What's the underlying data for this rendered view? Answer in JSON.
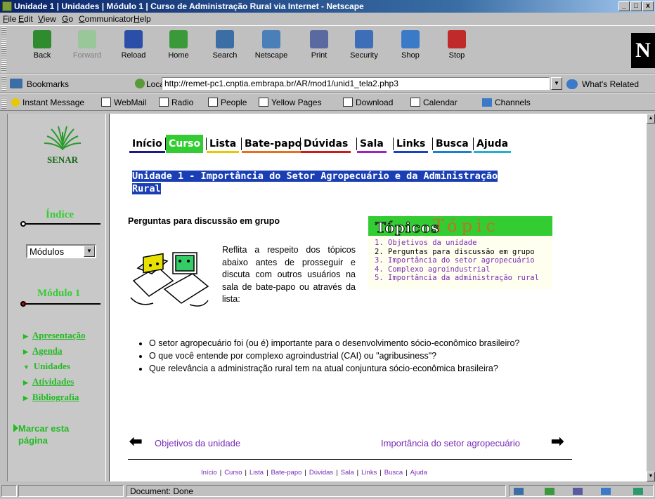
{
  "window": {
    "title": "Unidade 1 | Unidades | Módulo 1 | Curso de Administração Rural via Internet - Netscape",
    "controls": [
      "_",
      "□",
      "x"
    ]
  },
  "menu": [
    "File",
    "Edit",
    "View",
    "Go",
    "Communicator",
    "Help"
  ],
  "toolbar": {
    "buttons": [
      {
        "label": "Back",
        "icon": "back-icon",
        "color": "#2e8b2e"
      },
      {
        "label": "Forward",
        "icon": "forward-icon",
        "color": "#9ac79a"
      },
      {
        "label": "Reload",
        "icon": "reload-icon",
        "color": "#2b4fa8"
      },
      {
        "label": "Home",
        "icon": "home-icon",
        "color": "#3a9a3a"
      },
      {
        "label": "Search",
        "icon": "search-icon",
        "color": "#3a6ea5"
      },
      {
        "label": "Netscape",
        "icon": "netscape-icon",
        "color": "#4a7fb8"
      },
      {
        "label": "Print",
        "icon": "print-icon",
        "color": "#5a6aa0"
      },
      {
        "label": "Security",
        "icon": "lock-icon",
        "color": "#3d6eb8"
      },
      {
        "label": "Shop",
        "icon": "shop-icon",
        "color": "#3a7ac8"
      },
      {
        "label": "Stop",
        "icon": "stop-icon",
        "color": "#c02a2a"
      }
    ],
    "logo": "N"
  },
  "location": {
    "bookmarks_label": "Bookmarks",
    "location_label": "Location:",
    "url": "http://remet-pc1.cnptia.embrapa.br/AR/mod1/unid1_tela2.php3",
    "related_label": "What's Related"
  },
  "personal": [
    "Instant Message",
    "WebMail",
    "Radio",
    "People",
    "Yellow Pages",
    "Download",
    "Calendar",
    "Channels"
  ],
  "left": {
    "logo_text": "SENAR",
    "indice_label": "Índice",
    "select_value": "Módulos",
    "modulo_label": "Módulo 1",
    "nav": [
      {
        "label": "Apresentação",
        "expanded": false
      },
      {
        "label": "Agenda",
        "expanded": false
      },
      {
        "label": "Unidades",
        "expanded": true
      },
      {
        "label": "Atividades",
        "expanded": false
      },
      {
        "label": "Bibliografia",
        "expanded": false
      }
    ],
    "marcar": "Marcar esta página"
  },
  "main": {
    "tabs": [
      {
        "label": "Início",
        "color": "#1a1a8a",
        "active": false
      },
      {
        "label": "Curso",
        "color": "#33cc33",
        "active": true
      },
      {
        "label": "Lista",
        "color": "#e8c800",
        "active": false
      },
      {
        "label": "Bate-papo",
        "color": "#e8701a",
        "active": false
      },
      {
        "label": "Dúvidas",
        "color": "#d01a1a",
        "active": false
      },
      {
        "label": "Sala",
        "color": "#a020c0",
        "active": false
      },
      {
        "label": "Links",
        "color": "#1a40c8",
        "active": false
      },
      {
        "label": "Busca",
        "color": "#1a80d0",
        "active": false
      },
      {
        "label": "Ajuda",
        "color": "#20b0d0",
        "active": false
      }
    ],
    "title": "Unidade 1 - Importância do Setor Agropecuário e da Administração Rural",
    "subheading": "Perguntas para discussão em grupo",
    "intro": "Reflita a respeito dos tópicos abaixo antes de prosseguir e discuta com outros usuários na sala de bate-papo ou através da lista:",
    "topicos": {
      "heading": "Tópicos",
      "decoration": "Tópic",
      "items": [
        {
          "text": "Objetivos da unidade",
          "link": true
        },
        {
          "text": "Perguntas para discussão em grupo",
          "link": false
        },
        {
          "text": "Importância do setor agropecuário",
          "link": true
        },
        {
          "text": "Complexo agroindustrial",
          "link": true
        },
        {
          "text": "Importância da administração rural",
          "link": true
        }
      ]
    },
    "questions": [
      "O setor agropecuário foi (ou é) importante para o desenvolvimento sócio-econômico brasileiro?",
      "O que você entende por complexo agroindustrial (CAI) ou \"agribusiness\"?",
      "Que relevância a administração rural tem na atual conjuntura sócio-econômica brasileira?"
    ],
    "prev_link": "Objetivos da unidade",
    "next_link": "Importância do setor agropecuário",
    "bottom_links": [
      "Início",
      "Curso",
      "Lista",
      "Bate-papo",
      "Dúvidas",
      "Sala",
      "Links",
      "Busca",
      "Ajuda"
    ]
  },
  "status": {
    "text": "Document: Done"
  }
}
